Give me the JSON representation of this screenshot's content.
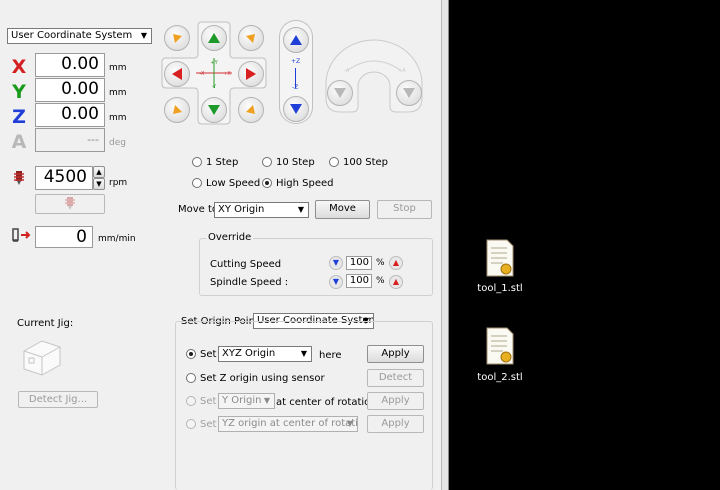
{
  "coord_system": {
    "selected": "User Coordinate System"
  },
  "axes": [
    {
      "name": "X",
      "value": "0.00",
      "unit": "mm",
      "color": "#d42020"
    },
    {
      "name": "Y",
      "value": "0.00",
      "unit": "mm",
      "color": "#1a9a1a"
    },
    {
      "name": "Z",
      "value": "0.00",
      "unit": "mm",
      "color": "#1f3fd8"
    },
    {
      "name": "A",
      "value": "---",
      "unit": "deg",
      "color": "#b8b8b8"
    }
  ],
  "spindle": {
    "value": "4500",
    "unit": "rpm"
  },
  "feed": {
    "value": "0",
    "unit": "mm/min"
  },
  "jog": {
    "xy_label_plus_y": "+Y",
    "xy_label_minus_y": "-Y",
    "xy_label_minus_x": "-X",
    "xy_label_plus_x": "+X",
    "z_label_plus": "+Z",
    "z_label_minus": "-Z",
    "rot_label_minus": "-A",
    "rot_label_plus": "+A"
  },
  "step": {
    "options": [
      "1 Step",
      "10 Step",
      "100 Step"
    ],
    "speed_options": [
      "Low Speed",
      "High Speed"
    ],
    "selected_speed": "High Speed"
  },
  "move_to": {
    "label": "Move to",
    "selected": "XY Origin",
    "move_button": "Move",
    "stop_button": "Stop"
  },
  "override": {
    "title": "Override",
    "cutting": {
      "label": "Cutting Speed",
      "value": "100",
      "unit": "%"
    },
    "spindle": {
      "label": "Spindle Speed :",
      "value": "100",
      "unit": "%"
    }
  },
  "jig": {
    "label": "Current Jig:",
    "detect_button": "Detect Jig..."
  },
  "origin": {
    "label": "Set Origin Point",
    "system": "User Coordinate System",
    "row1": {
      "set": "Set",
      "combo": "XYZ Origin",
      "suffix": "here",
      "button": "Apply"
    },
    "row2": {
      "label": "Set Z origin using sensor",
      "button": "Detect"
    },
    "row3": {
      "set": "Set",
      "combo": "Y Origin",
      "suffix": "at center of rotation",
      "button": "Apply"
    },
    "row4": {
      "set": "Set",
      "combo": "YZ origin at center of rotation",
      "button": "Apply"
    }
  },
  "desktop": {
    "files": [
      "tool_1.stl",
      "tool_2.stl"
    ]
  }
}
